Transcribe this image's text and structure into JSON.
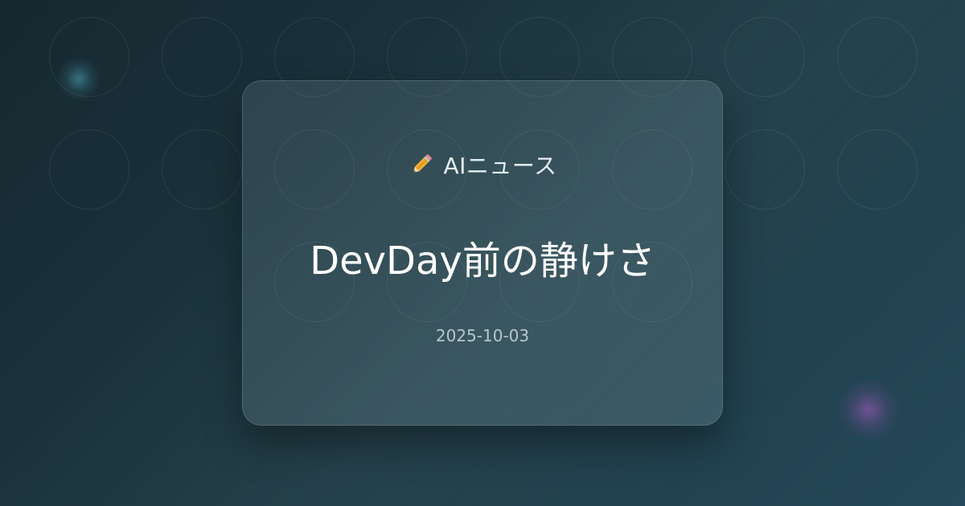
{
  "card": {
    "category_icon": "pencil-icon",
    "category_label": "AIニュース",
    "title": "DevDay前の静けさ",
    "date": "2025-10-03"
  },
  "colors": {
    "background_start": "#162830",
    "background_end": "#25495a",
    "accent_glow_teal": "#50aabe",
    "accent_glow_violet": "#a05abe"
  }
}
